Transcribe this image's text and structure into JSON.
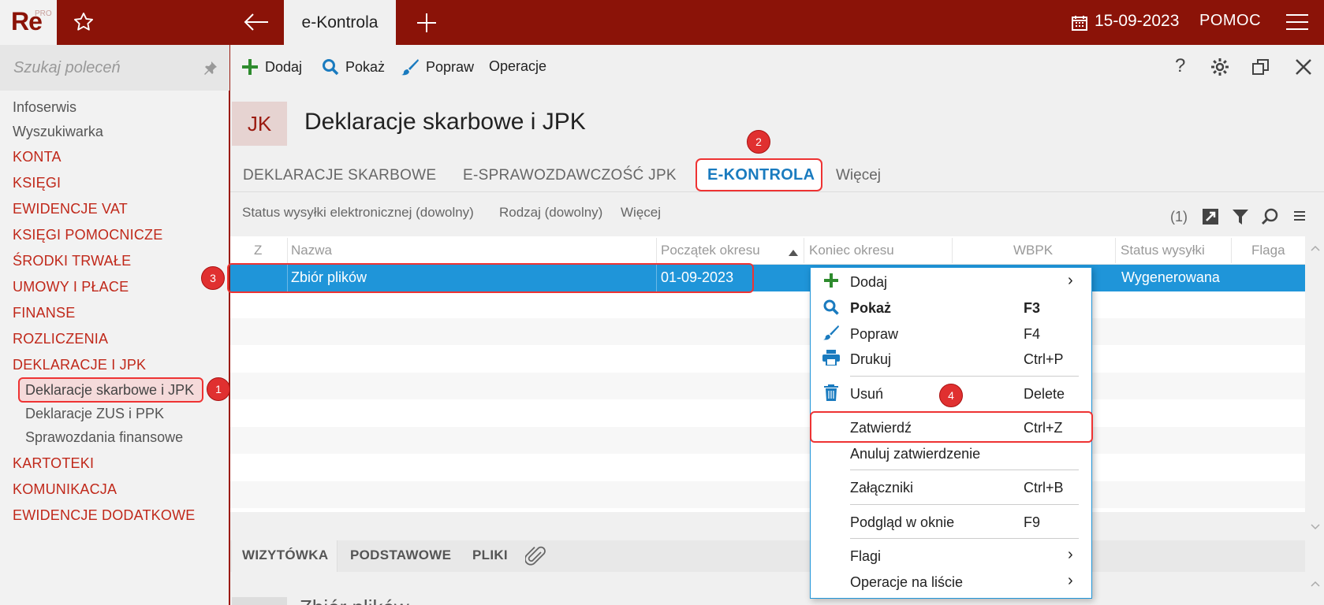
{
  "app": {
    "logo": "Re",
    "logo_badge": "PRO",
    "active_tab": "e-Kontrola",
    "date": "15-09-2023",
    "help": "POMOC"
  },
  "icons": {
    "favorite": "star-icon",
    "back": "arrow-left-icon",
    "new_tab": "plus-icon",
    "calendar": "calendar-icon",
    "menu": "hamburger-icon"
  },
  "sidebar": {
    "search_placeholder": "Szukaj poleceń",
    "items": [
      {
        "label": "Infoserwis"
      },
      {
        "label": "Wyszukiwarka"
      },
      {
        "label": "KONTA"
      },
      {
        "label": "KSIĘGI"
      },
      {
        "label": "EWIDENCJE VAT"
      },
      {
        "label": "KSIĘGI POMOCNICZE"
      },
      {
        "label": "ŚRODKI TRWAŁE"
      },
      {
        "label": "UMOWY I PŁACE"
      },
      {
        "label": "FINANSE"
      },
      {
        "label": "ROZLICZENIA"
      },
      {
        "label": "DEKLARACJE I JPK"
      },
      {
        "label": "Deklaracje skarbowe i JPK"
      },
      {
        "label": "Deklaracje ZUS i PPK"
      },
      {
        "label": "Sprawozdania finansowe"
      },
      {
        "label": "KARTOTEKI"
      },
      {
        "label": "KOMUNIKACJA"
      },
      {
        "label": "EWIDENCJE DODATKOWE"
      }
    ]
  },
  "toolbar": {
    "add": "Dodaj",
    "show": "Pokaż",
    "edit": "Popraw",
    "operations": "Operacje"
  },
  "header": {
    "badge": "JK",
    "title": "Deklaracje skarbowe i JPK"
  },
  "tabs": [
    "DEKLARACJE SKARBOWE",
    "E-SPRAWOZDAWCZOŚĆ JPK",
    "E-KONTROLA",
    "Więcej"
  ],
  "filters": {
    "status": "Status wysyłki elektronicznej (dowolny)",
    "kind": "Rodzaj (dowolny)",
    "more": "Więcej",
    "count": "(1)"
  },
  "grid": {
    "columns": [
      "Z",
      "Nazwa",
      "Początek okresu",
      "Koniec okresu",
      "WBPK",
      "Status wysyłki",
      "Flaga"
    ],
    "rows": [
      {
        "name": "Zbiór plików",
        "start": "01-09-2023",
        "status": "Wygenerowana"
      }
    ]
  },
  "bottom_tabs": [
    "WIZYTÓWKA",
    "PODSTAWOWE",
    "PLIKI"
  ],
  "lower_title": "Zbiór plików",
  "context_menu": {
    "items": [
      {
        "label": "Dodaj",
        "shortcut": ""
      },
      {
        "label": "Pokaż",
        "shortcut": "F3"
      },
      {
        "label": "Popraw",
        "shortcut": "F4"
      },
      {
        "label": "Drukuj",
        "shortcut": "Ctrl+P"
      },
      {
        "label": "Usuń",
        "shortcut": "Delete"
      },
      {
        "label": "Zatwierdź",
        "shortcut": "Ctrl+Z"
      },
      {
        "label": "Anuluj zatwierdzenie",
        "shortcut": ""
      },
      {
        "label": "Załączniki",
        "shortcut": "Ctrl+B"
      },
      {
        "label": "Podgląd w oknie",
        "shortcut": "F9"
      },
      {
        "label": "Flagi",
        "shortcut": ""
      },
      {
        "label": "Operacje na liście",
        "shortcut": ""
      }
    ]
  },
  "annotations": [
    "1",
    "2",
    "3",
    "4"
  ],
  "colors": {
    "brand": "#8b1308",
    "accent": "#1f95d9",
    "highlight": "#e33333"
  }
}
